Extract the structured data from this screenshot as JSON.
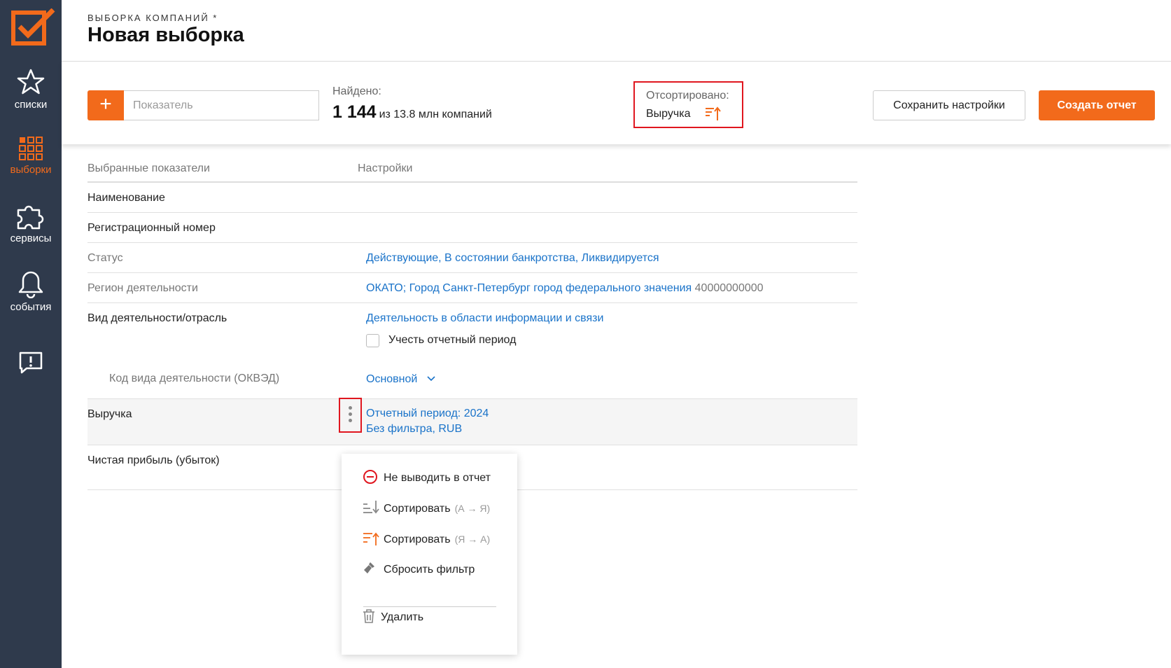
{
  "colors": {
    "accent": "#f26a1b",
    "sidebar": "#2f3a4c",
    "link": "#1a73c9",
    "highlight": "#e0161f"
  },
  "sidebar": {
    "items": [
      {
        "label": "списки",
        "icon": "star-icon"
      },
      {
        "label": "выборки",
        "icon": "grid-icon",
        "active": true
      },
      {
        "label": "сервисы",
        "icon": "puzzle-icon"
      },
      {
        "label": "события",
        "icon": "bell-icon"
      },
      {
        "label": "",
        "icon": "feedback-icon"
      }
    ]
  },
  "header": {
    "breadcrumb": "ВЫБОРКА КОМПАНИЙ *",
    "title": "Новая выборка"
  },
  "toolbar": {
    "add_label": "+",
    "indicator_placeholder": "Показатель",
    "found_label": "Найдено:",
    "found_count": "1 144",
    "found_suffix": "из 13.8 млн компаний",
    "sorted_label": "Отсортировано:",
    "sorted_value": "Выручка",
    "save_label": "Сохранить настройки",
    "create_label": "Создать отчет"
  },
  "table": {
    "headers": {
      "indicators": "Выбранные показатели",
      "settings": "Настройки"
    },
    "rows": {
      "name": {
        "label": "Наименование"
      },
      "reg": {
        "label": "Регистрационный номер"
      },
      "status": {
        "label": "Статус",
        "value": "Действующие, В состоянии банкротства, Ликвидируется"
      },
      "region": {
        "label": "Регион деятельности",
        "value": "ОКАТО; Город Санкт-Петербург город федерального значения",
        "code": "40000000000"
      },
      "activity": {
        "label": "Вид деятельности/отрасль",
        "value": "Деятельность в области информации и связи",
        "checkbox_label": "Учесть отчетный период"
      },
      "okved": {
        "label": "Код вида деятельности (ОКВЭД)",
        "value": "Основной"
      },
      "revenue": {
        "label": "Выручка",
        "period": "Отчетный период: 2024",
        "filter": "Без фильтра, RUB"
      },
      "profit": {
        "label": "Чистая прибыль (убыток)"
      }
    }
  },
  "menu": {
    "exclude": "Не выводить в отчет",
    "sort_asc": "Сортировать",
    "sort_asc_hint": "(А → Я)",
    "sort_desc": "Сортировать",
    "sort_desc_hint": "(Я → А)",
    "reset": "Сбросить фильтр",
    "delete": "Удалить"
  }
}
